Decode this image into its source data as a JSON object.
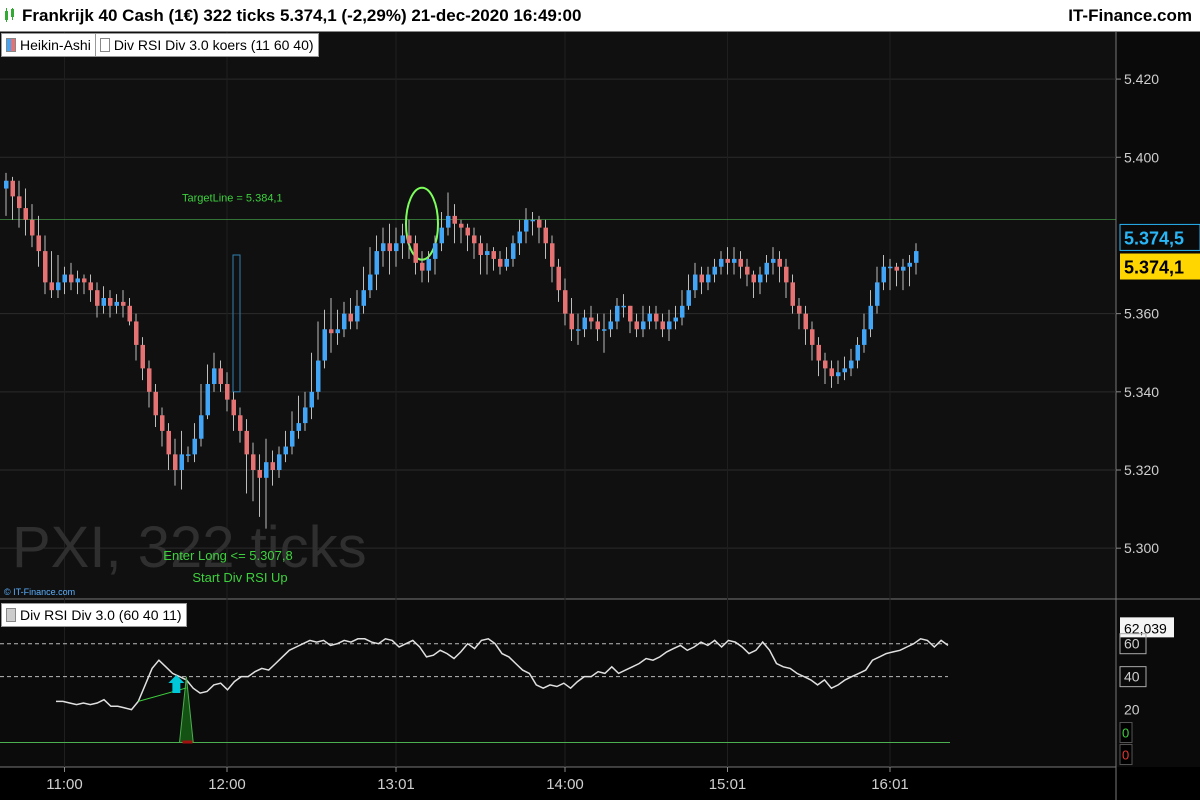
{
  "window": {
    "title": "Frankrijk 40 Cash (1€) 322 ticks 5.374,1 (-2,29%) 21-dec-2020 16:49:00",
    "brand": "IT-Finance.com"
  },
  "price_panel": {
    "legend": [
      {
        "label": "Heikin-Ashi",
        "swatch": "#e67373"
      },
      {
        "label": "Div RSI Div 3.0 koers (11 60 40)",
        "swatch": "#ffffff"
      }
    ],
    "watermark": "PXI, 322 ticks",
    "copyright": "© IT-Finance.com",
    "annotations": {
      "target_line": "TargetLine = 5.384,1",
      "enter_long": "Enter Long <= 5.307,8",
      "start_div": "Start Div RSI Up"
    },
    "last_price_badges": [
      {
        "text": "5.374,5",
        "color": "#29b6f6"
      },
      {
        "text": "5.374,1",
        "color": "#ffd600"
      }
    ]
  },
  "rsi_panel": {
    "legend": "Div RSI Div 3.0 (60 40 11)",
    "value_badge": "62,039",
    "level_labels": [
      "60",
      "40",
      "20"
    ],
    "signal_labels": [
      "0",
      "0"
    ]
  },
  "colors": {
    "bull": "#42a5f5",
    "bear": "#e57373",
    "target": "#4caf50",
    "annot_green": "#3ed13e",
    "rsi_line": "#e0e0e0",
    "arrow": "#00c8d8"
  },
  "chart_data": [
    {
      "type": "candlestick",
      "style": "Heikin-Ashi",
      "title": "Frankrijk 40 Cash (1€) 322 ticks",
      "y_ticks": [
        "5.420",
        "5.400",
        "5.360",
        "5.340",
        "5.320",
        "5.300"
      ],
      "x_ticks": [
        "11:00",
        "12:00",
        "13:01",
        "14:00",
        "15:01",
        "16:01"
      ],
      "ylim": [
        5287,
        5430
      ],
      "target_line": 5384.1,
      "last_price": 5374.1,
      "grid": true,
      "candles": [
        {
          "o": 5392,
          "c": 5394,
          "h": 5396,
          "l": 5385
        },
        {
          "o": 5394,
          "c": 5390,
          "h": 5395,
          "l": 5384
        },
        {
          "o": 5390,
          "c": 5387,
          "h": 5394,
          "l": 5382
        },
        {
          "o": 5387,
          "c": 5384,
          "h": 5392,
          "l": 5380
        },
        {
          "o": 5384,
          "c": 5380,
          "h": 5388,
          "l": 5377
        },
        {
          "o": 5380,
          "c": 5376,
          "h": 5385,
          "l": 5372
        },
        {
          "o": 5376,
          "c": 5368,
          "h": 5380,
          "l": 5365
        },
        {
          "o": 5368,
          "c": 5366,
          "h": 5376,
          "l": 5364
        },
        {
          "o": 5366,
          "c": 5368,
          "h": 5375,
          "l": 5364
        },
        {
          "o": 5368,
          "c": 5370,
          "h": 5372,
          "l": 5365
        },
        {
          "o": 5370,
          "c": 5368,
          "h": 5373,
          "l": 5366
        },
        {
          "o": 5368,
          "c": 5369,
          "h": 5371,
          "l": 5365
        },
        {
          "o": 5369,
          "c": 5368,
          "h": 5370,
          "l": 5365
        },
        {
          "o": 5368,
          "c": 5366,
          "h": 5370,
          "l": 5363
        },
        {
          "o": 5366,
          "c": 5362,
          "h": 5368,
          "l": 5359
        },
        {
          "o": 5362,
          "c": 5364,
          "h": 5367,
          "l": 5360
        },
        {
          "o": 5364,
          "c": 5362,
          "h": 5366,
          "l": 5359
        },
        {
          "o": 5362,
          "c": 5363,
          "h": 5365,
          "l": 5360
        },
        {
          "o": 5363,
          "c": 5362,
          "h": 5366,
          "l": 5359
        },
        {
          "o": 5362,
          "c": 5358,
          "h": 5364,
          "l": 5357
        },
        {
          "o": 5358,
          "c": 5352,
          "h": 5360,
          "l": 5348
        },
        {
          "o": 5352,
          "c": 5346,
          "h": 5354,
          "l": 5343
        },
        {
          "o": 5346,
          "c": 5340,
          "h": 5348,
          "l": 5336
        },
        {
          "o": 5340,
          "c": 5334,
          "h": 5342,
          "l": 5331
        },
        {
          "o": 5334,
          "c": 5330,
          "h": 5336,
          "l": 5326
        },
        {
          "o": 5330,
          "c": 5324,
          "h": 5332,
          "l": 5320
        },
        {
          "o": 5324,
          "c": 5320,
          "h": 5328,
          "l": 5316
        },
        {
          "o": 5320,
          "c": 5324,
          "h": 5330,
          "l": 5315
        },
        {
          "o": 5324,
          "c": 5324,
          "h": 5326,
          "l": 5322
        },
        {
          "o": 5324,
          "c": 5328,
          "h": 5332,
          "l": 5322
        },
        {
          "o": 5328,
          "c": 5334,
          "h": 5342,
          "l": 5326
        },
        {
          "o": 5334,
          "c": 5342,
          "h": 5347,
          "l": 5333
        },
        {
          "o": 5342,
          "c": 5346,
          "h": 5350,
          "l": 5340
        },
        {
          "o": 5346,
          "c": 5342,
          "h": 5348,
          "l": 5340
        },
        {
          "o": 5342,
          "c": 5338,
          "h": 5345,
          "l": 5335
        },
        {
          "o": 5338,
          "c": 5334,
          "h": 5340,
          "l": 5330
        },
        {
          "o": 5334,
          "c": 5330,
          "h": 5336,
          "l": 5327
        },
        {
          "o": 5330,
          "c": 5324,
          "h": 5333,
          "l": 5314
        },
        {
          "o": 5324,
          "c": 5320,
          "h": 5327,
          "l": 5312
        },
        {
          "o": 5320,
          "c": 5318,
          "h": 5324,
          "l": 5308
        },
        {
          "o": 5318,
          "c": 5322,
          "h": 5328,
          "l": 5305
        },
        {
          "o": 5322,
          "c": 5320,
          "h": 5325,
          "l": 5316
        },
        {
          "o": 5320,
          "c": 5324,
          "h": 5326,
          "l": 5318
        },
        {
          "o": 5324,
          "c": 5326,
          "h": 5330,
          "l": 5322
        },
        {
          "o": 5326,
          "c": 5330,
          "h": 5335,
          "l": 5324
        },
        {
          "o": 5330,
          "c": 5332,
          "h": 5339,
          "l": 5328
        },
        {
          "o": 5332,
          "c": 5336,
          "h": 5340,
          "l": 5330
        },
        {
          "o": 5336,
          "c": 5340,
          "h": 5350,
          "l": 5333
        },
        {
          "o": 5340,
          "c": 5348,
          "h": 5358,
          "l": 5338
        },
        {
          "o": 5348,
          "c": 5356,
          "h": 5361,
          "l": 5346
        },
        {
          "o": 5356,
          "c": 5355,
          "h": 5364,
          "l": 5350
        },
        {
          "o": 5355,
          "c": 5356,
          "h": 5361,
          "l": 5352
        },
        {
          "o": 5356,
          "c": 5360,
          "h": 5363,
          "l": 5354
        },
        {
          "o": 5360,
          "c": 5358,
          "h": 5364,
          "l": 5356
        },
        {
          "o": 5358,
          "c": 5362,
          "h": 5366,
          "l": 5356
        },
        {
          "o": 5362,
          "c": 5366,
          "h": 5372,
          "l": 5360
        },
        {
          "o": 5366,
          "c": 5370,
          "h": 5377,
          "l": 5364
        },
        {
          "o": 5370,
          "c": 5376,
          "h": 5380,
          "l": 5366
        },
        {
          "o": 5376,
          "c": 5378,
          "h": 5382,
          "l": 5372
        },
        {
          "o": 5378,
          "c": 5376,
          "h": 5383,
          "l": 5370
        },
        {
          "o": 5376,
          "c": 5378,
          "h": 5382,
          "l": 5372
        },
        {
          "o": 5378,
          "c": 5380,
          "h": 5383,
          "l": 5374
        },
        {
          "o": 5380,
          "c": 5378,
          "h": 5384,
          "l": 5374
        },
        {
          "o": 5378,
          "c": 5373,
          "h": 5380,
          "l": 5370
        },
        {
          "o": 5373,
          "c": 5371,
          "h": 5376,
          "l": 5368
        },
        {
          "o": 5371,
          "c": 5374,
          "h": 5376,
          "l": 5368
        },
        {
          "o": 5374,
          "c": 5378,
          "h": 5380,
          "l": 5370
        },
        {
          "o": 5378,
          "c": 5382,
          "h": 5386,
          "l": 5376
        },
        {
          "o": 5382,
          "c": 5385,
          "h": 5391,
          "l": 5380
        },
        {
          "o": 5385,
          "c": 5383,
          "h": 5388,
          "l": 5378
        },
        {
          "o": 5383,
          "c": 5382,
          "h": 5384,
          "l": 5378
        },
        {
          "o": 5382,
          "c": 5380,
          "h": 5383,
          "l": 5376
        },
        {
          "o": 5380,
          "c": 5378,
          "h": 5382,
          "l": 5374
        },
        {
          "o": 5378,
          "c": 5375,
          "h": 5380,
          "l": 5370
        },
        {
          "o": 5375,
          "c": 5376,
          "h": 5378,
          "l": 5370
        },
        {
          "o": 5376,
          "c": 5374,
          "h": 5377,
          "l": 5371
        },
        {
          "o": 5374,
          "c": 5372,
          "h": 5376,
          "l": 5370
        },
        {
          "o": 5372,
          "c": 5374,
          "h": 5377,
          "l": 5371
        },
        {
          "o": 5374,
          "c": 5378,
          "h": 5380,
          "l": 5372
        },
        {
          "o": 5378,
          "c": 5381,
          "h": 5384,
          "l": 5375
        },
        {
          "o": 5381,
          "c": 5384,
          "h": 5387,
          "l": 5378
        },
        {
          "o": 5384,
          "c": 5384,
          "h": 5386,
          "l": 5380
        },
        {
          "o": 5384,
          "c": 5382,
          "h": 5385,
          "l": 5378
        },
        {
          "o": 5382,
          "c": 5378,
          "h": 5384,
          "l": 5374
        },
        {
          "o": 5378,
          "c": 5372,
          "h": 5380,
          "l": 5368
        },
        {
          "o": 5372,
          "c": 5366,
          "h": 5374,
          "l": 5363
        },
        {
          "o": 5366,
          "c": 5360,
          "h": 5369,
          "l": 5357
        },
        {
          "o": 5360,
          "c": 5356,
          "h": 5364,
          "l": 5353
        },
        {
          "o": 5356,
          "c": 5356,
          "h": 5360,
          "l": 5352
        },
        {
          "o": 5356,
          "c": 5359,
          "h": 5361,
          "l": 5354
        },
        {
          "o": 5359,
          "c": 5358,
          "h": 5362,
          "l": 5356
        },
        {
          "o": 5358,
          "c": 5356,
          "h": 5360,
          "l": 5353
        },
        {
          "o": 5356,
          "c": 5356,
          "h": 5360,
          "l": 5350
        },
        {
          "o": 5356,
          "c": 5358,
          "h": 5361,
          "l": 5354
        },
        {
          "o": 5358,
          "c": 5362,
          "h": 5364,
          "l": 5356
        },
        {
          "o": 5362,
          "c": 5362,
          "h": 5365,
          "l": 5359
        },
        {
          "o": 5362,
          "c": 5358,
          "h": 5362,
          "l": 5355
        },
        {
          "o": 5358,
          "c": 5356,
          "h": 5360,
          "l": 5354
        },
        {
          "o": 5356,
          "c": 5358,
          "h": 5362,
          "l": 5354
        },
        {
          "o": 5358,
          "c": 5360,
          "h": 5362,
          "l": 5356
        },
        {
          "o": 5360,
          "c": 5358,
          "h": 5362,
          "l": 5356
        },
        {
          "o": 5358,
          "c": 5356,
          "h": 5360,
          "l": 5354
        },
        {
          "o": 5356,
          "c": 5358,
          "h": 5361,
          "l": 5353
        },
        {
          "o": 5358,
          "c": 5359,
          "h": 5362,
          "l": 5356
        },
        {
          "o": 5359,
          "c": 5362,
          "h": 5366,
          "l": 5357
        },
        {
          "o": 5362,
          "c": 5366,
          "h": 5370,
          "l": 5361
        },
        {
          "o": 5366,
          "c": 5370,
          "h": 5373,
          "l": 5364
        },
        {
          "o": 5370,
          "c": 5368,
          "h": 5372,
          "l": 5365
        },
        {
          "o": 5368,
          "c": 5370,
          "h": 5372,
          "l": 5366
        },
        {
          "o": 5370,
          "c": 5372,
          "h": 5374,
          "l": 5368
        },
        {
          "o": 5372,
          "c": 5374,
          "h": 5376,
          "l": 5370
        },
        {
          "o": 5374,
          "c": 5373,
          "h": 5377,
          "l": 5370
        },
        {
          "o": 5373,
          "c": 5374,
          "h": 5377,
          "l": 5370
        },
        {
          "o": 5374,
          "c": 5372,
          "h": 5376,
          "l": 5369
        },
        {
          "o": 5372,
          "c": 5370,
          "h": 5374,
          "l": 5367
        },
        {
          "o": 5370,
          "c": 5368,
          "h": 5371,
          "l": 5364
        },
        {
          "o": 5368,
          "c": 5370,
          "h": 5372,
          "l": 5365
        },
        {
          "o": 5370,
          "c": 5373,
          "h": 5375,
          "l": 5368
        },
        {
          "o": 5373,
          "c": 5374,
          "h": 5377,
          "l": 5370
        },
        {
          "o": 5374,
          "c": 5372,
          "h": 5376,
          "l": 5368
        },
        {
          "o": 5372,
          "c": 5368,
          "h": 5374,
          "l": 5364
        },
        {
          "o": 5368,
          "c": 5362,
          "h": 5370,
          "l": 5360
        },
        {
          "o": 5362,
          "c": 5360,
          "h": 5364,
          "l": 5356
        },
        {
          "o": 5360,
          "c": 5356,
          "h": 5362,
          "l": 5352
        },
        {
          "o": 5356,
          "c": 5352,
          "h": 5358,
          "l": 5348
        },
        {
          "o": 5352,
          "c": 5348,
          "h": 5354,
          "l": 5344
        },
        {
          "o": 5348,
          "c": 5346,
          "h": 5350,
          "l": 5342
        },
        {
          "o": 5346,
          "c": 5344,
          "h": 5348,
          "l": 5341
        },
        {
          "o": 5344,
          "c": 5345,
          "h": 5348,
          "l": 5342
        },
        {
          "o": 5345,
          "c": 5346,
          "h": 5349,
          "l": 5343
        },
        {
          "o": 5346,
          "c": 5348,
          "h": 5351,
          "l": 5344
        },
        {
          "o": 5348,
          "c": 5352,
          "h": 5354,
          "l": 5346
        },
        {
          "o": 5352,
          "c": 5356,
          "h": 5360,
          "l": 5350
        },
        {
          "o": 5356,
          "c": 5362,
          "h": 5366,
          "l": 5354
        },
        {
          "o": 5362,
          "c": 5368,
          "h": 5372,
          "l": 5360
        },
        {
          "o": 5368,
          "c": 5372,
          "h": 5375,
          "l": 5366
        },
        {
          "o": 5372,
          "c": 5372,
          "h": 5374,
          "l": 5366
        },
        {
          "o": 5372,
          "c": 5371,
          "h": 5373,
          "l": 5367
        },
        {
          "o": 5371,
          "c": 5372,
          "h": 5374,
          "l": 5366
        },
        {
          "o": 5372,
          "c": 5373,
          "h": 5375,
          "l": 5367
        },
        {
          "o": 5373,
          "c": 5376,
          "h": 5378,
          "l": 5370
        }
      ]
    },
    {
      "type": "line",
      "title": "Div RSI Div 3.0 (60 40 11)",
      "y_ticks": [
        60,
        40,
        20,
        0
      ],
      "ylim": [
        -10,
        75
      ],
      "levels": [
        60,
        40
      ],
      "last_value": 62.039,
      "rsi": [
        25,
        25,
        24,
        23,
        24,
        23,
        24,
        26,
        22,
        22,
        21,
        20,
        25,
        35,
        45,
        50,
        46,
        42,
        40,
        38,
        33,
        30,
        31,
        35,
        36,
        32,
        37,
        40,
        40,
        43,
        45,
        44,
        48,
        52,
        56,
        58,
        60,
        62,
        61,
        62,
        59,
        60,
        62,
        61,
        63,
        63,
        61,
        60,
        63,
        62,
        58,
        60,
        62,
        58,
        52,
        53,
        56,
        54,
        51,
        55,
        60,
        57,
        62,
        63,
        60,
        54,
        52,
        48,
        44,
        42,
        35,
        33,
        35,
        34,
        36,
        33,
        37,
        40,
        40,
        43,
        42,
        46,
        42,
        44,
        46,
        48,
        51,
        50,
        52,
        55,
        57,
        59,
        56,
        58,
        61,
        59,
        62,
        58,
        62,
        61,
        58,
        54,
        56,
        61,
        56,
        48,
        46,
        45,
        42,
        40,
        38,
        35,
        38,
        33,
        35,
        38,
        40,
        42,
        44,
        50,
        52,
        54,
        55,
        56,
        58,
        60,
        63,
        62,
        58,
        62,
        59
      ],
      "signal": {
        "start": 18,
        "end": 20,
        "peak": 40
      },
      "divergence": {
        "from": 12,
        "to": 19,
        "arrow_at": 19
      }
    }
  ]
}
